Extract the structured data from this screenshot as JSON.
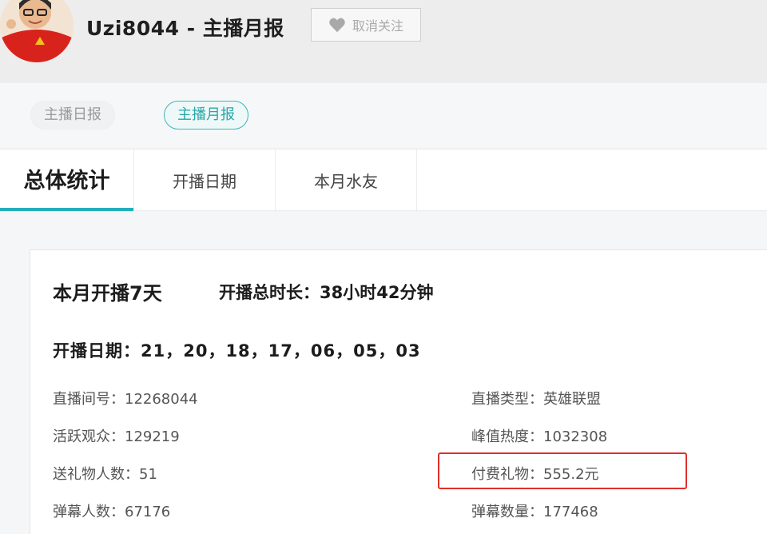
{
  "header": {
    "title": "Uzi8044 - 主播月报",
    "follow_button_label": "取消关注"
  },
  "subtabs": {
    "daily_label": "主播日报",
    "monthly_label": "主播月报"
  },
  "tabs": {
    "overall": "总体统计",
    "dates": "开播日期",
    "fans": "本月水友"
  },
  "summary": {
    "days_line": "本月开播7天",
    "duration_line": "开播总时长：38小时42分钟",
    "dates_line": "开播日期：21，20，18，17，06，05，03"
  },
  "stats": {
    "room_id": "直播间号：12268044",
    "category": "直播类型：英雄联盟",
    "active_viewers": "活跃观众：129219",
    "peak_heat": "峰值热度：1032308",
    "gift_senders": "送礼物人数：51",
    "paid_gifts": "付费礼物：555.2元",
    "danmaku_users": "弹幕人数：67176",
    "danmaku_count": "弹幕数量：177468"
  },
  "colors": {
    "accent": "#23aebb",
    "highlight_border": "#e0302c"
  },
  "icons": {
    "follow": "heart-icon"
  }
}
